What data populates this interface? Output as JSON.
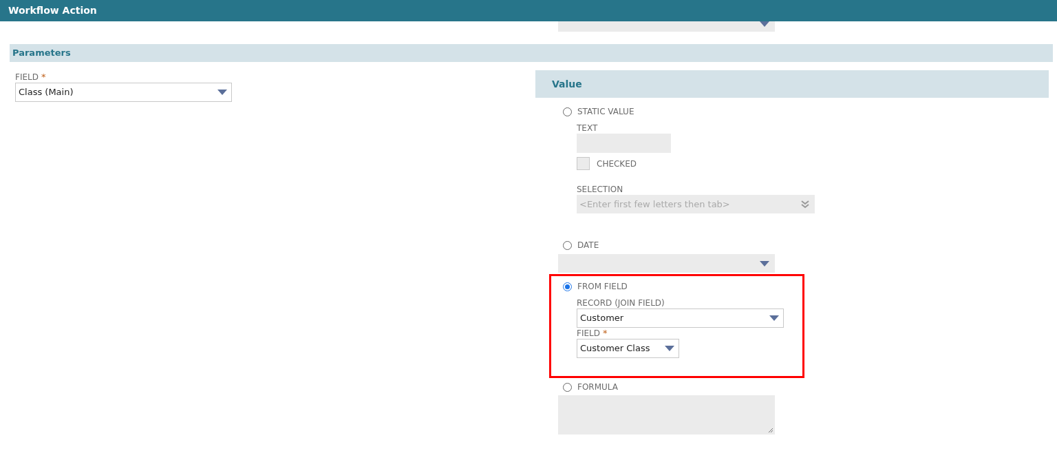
{
  "window": {
    "title": "Workflow Action"
  },
  "parameters": {
    "title": "Parameters",
    "field": {
      "label": "FIELD",
      "required_mark": "*",
      "value": "Class (Main)"
    }
  },
  "value_panel": {
    "title": "Value",
    "options": [
      {
        "label": "STATIC VALUE",
        "selected": false,
        "fields": [
          {
            "kind": "text",
            "label": "TEXT"
          },
          {
            "kind": "checkbox",
            "label": "CHECKED",
            "checked": false
          },
          {
            "kind": "lookup",
            "label": "SELECTION",
            "placeholder": "<Enter first few letters then tab>"
          }
        ]
      },
      {
        "label": "DATE",
        "selected": false,
        "fields": [
          {
            "kind": "date"
          }
        ]
      },
      {
        "label": "FROM FIELD",
        "selected": true,
        "fields": [
          {
            "kind": "dropdown",
            "label": "RECORD (JOIN FIELD)",
            "value": "Customer"
          },
          {
            "kind": "dropdown",
            "label": "FIELD",
            "required_mark": "*",
            "value": "Customer Class"
          }
        ]
      },
      {
        "label": "FORMULA",
        "selected": false,
        "fields": [
          {
            "kind": "textarea"
          }
        ]
      }
    ]
  }
}
